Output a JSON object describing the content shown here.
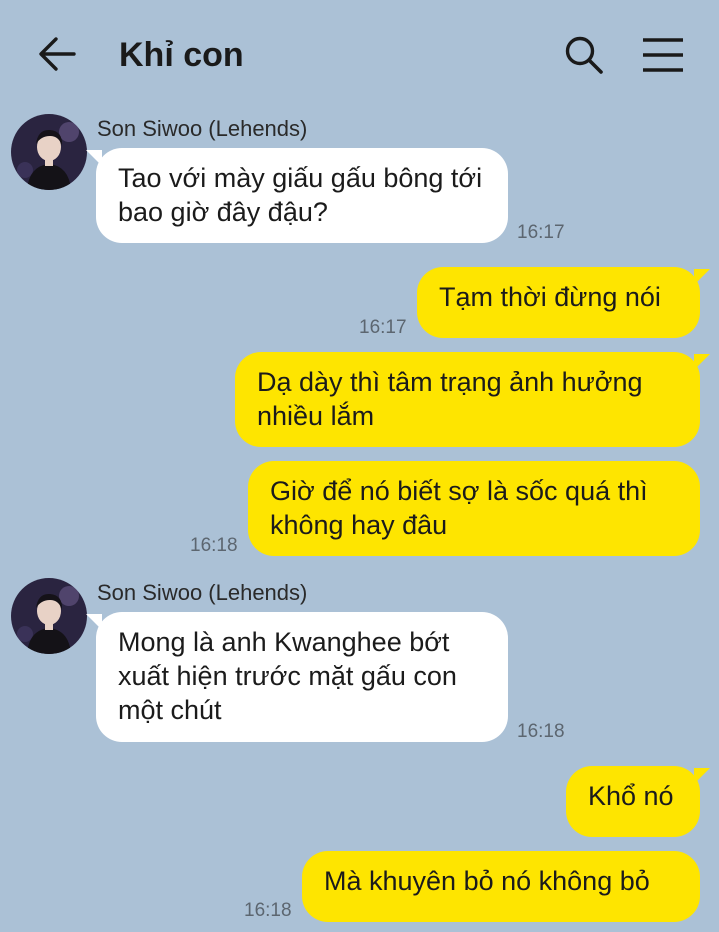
{
  "header": {
    "title": "Khỉ con",
    "back_icon": "arrow-left-icon",
    "search_icon": "search-icon",
    "menu_icon": "hamburger-menu-icon"
  },
  "colors": {
    "background": "#abc1d6",
    "incoming_bubble": "#ffffff",
    "outgoing_bubble": "#fee500"
  },
  "messages": [
    {
      "sender": "Son Siwoo (Lehends)",
      "text": "Tao với mày giấu gấu bông tới bao giờ đây đậu?",
      "time": "16:17"
    },
    {
      "text": "Tạm thời đừng nói",
      "time": "16:17"
    },
    {
      "text": "Dạ dày thì tâm trạng ảnh hưởng nhiều lắm"
    },
    {
      "text": "Giờ để nó biết sợ là sốc quá thì không hay đâu",
      "time": "16:18"
    },
    {
      "sender": "Son Siwoo (Lehends)",
      "text": "Mong là anh Kwanghee bớt xuất hiện trước mặt gấu con một chút",
      "time": "16:18"
    },
    {
      "text": "Khổ nó"
    },
    {
      "text": "Mà khuyên bỏ nó không bỏ",
      "time": "16:18"
    }
  ]
}
